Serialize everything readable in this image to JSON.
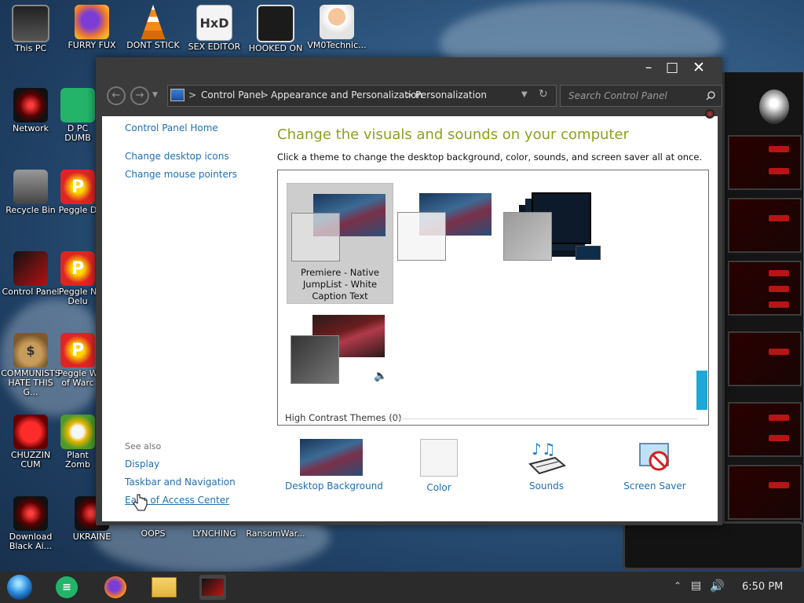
{
  "desktop": {
    "icons": [
      {
        "label": "This PC"
      },
      {
        "label": "FURRY FUX"
      },
      {
        "label": "DONT STICK"
      },
      {
        "label": "SEX EDITOR"
      },
      {
        "label": "HOOKED ON"
      },
      {
        "label": "VM0Technic..."
      },
      {
        "label": "Network"
      },
      {
        "label": "D PC\nDUMB"
      },
      {
        "label": "Recycle Bin"
      },
      {
        "label": "Peggle D"
      },
      {
        "label": "Control Panel"
      },
      {
        "label": "Peggle N\nDelu"
      },
      {
        "label": "COMMUNISTS\nHATE THIS G..."
      },
      {
        "label": "Peggle W\nof Warc"
      },
      {
        "label": "CHUZZIN\nCUM"
      },
      {
        "label": "Plant\nZomb"
      },
      {
        "label": "Download\nBlack Ai..."
      },
      {
        "label": "UKRAINE"
      },
      {
        "label": "OOPS"
      },
      {
        "label": "LYNCHING"
      },
      {
        "label": "RansomWar..."
      }
    ]
  },
  "window": {
    "address": {
      "crumbs": [
        "Control Panel",
        "Appearance and Personalization",
        "Personalization"
      ],
      "separator": ">"
    },
    "search": {
      "placeholder": "Search Control Panel"
    },
    "sidebar": {
      "home": "Control Panel Home",
      "links": [
        "Change desktop icons",
        "Change mouse pointers"
      ],
      "see_also": "See also",
      "see_also_links": [
        "Display",
        "Taskbar and Navigation",
        "Ease of Access Center"
      ]
    },
    "main": {
      "heading": "Change the visuals and sounds on your computer",
      "subheading": "Click a theme to change the desktop background, color, sounds, and screen saver all at once.",
      "selected_theme": "Premiere - Native JumpList - White Caption Text",
      "group_label": "High Contrast Themes (0)"
    },
    "bottom": {
      "items": [
        "Desktop Background",
        "Color",
        "Sounds",
        "Screen Saver"
      ]
    }
  },
  "taskbar": {
    "time": "6:50 PM",
    "apps": [
      "start-orb",
      "notes",
      "firefox",
      "file-explorer",
      "control-panel"
    ]
  },
  "colors": {
    "heading": "#8aa21e",
    "link": "#1f6fb2",
    "selected_theme": "#cdcdcd",
    "scroll_accent": "#1ea7d8"
  }
}
